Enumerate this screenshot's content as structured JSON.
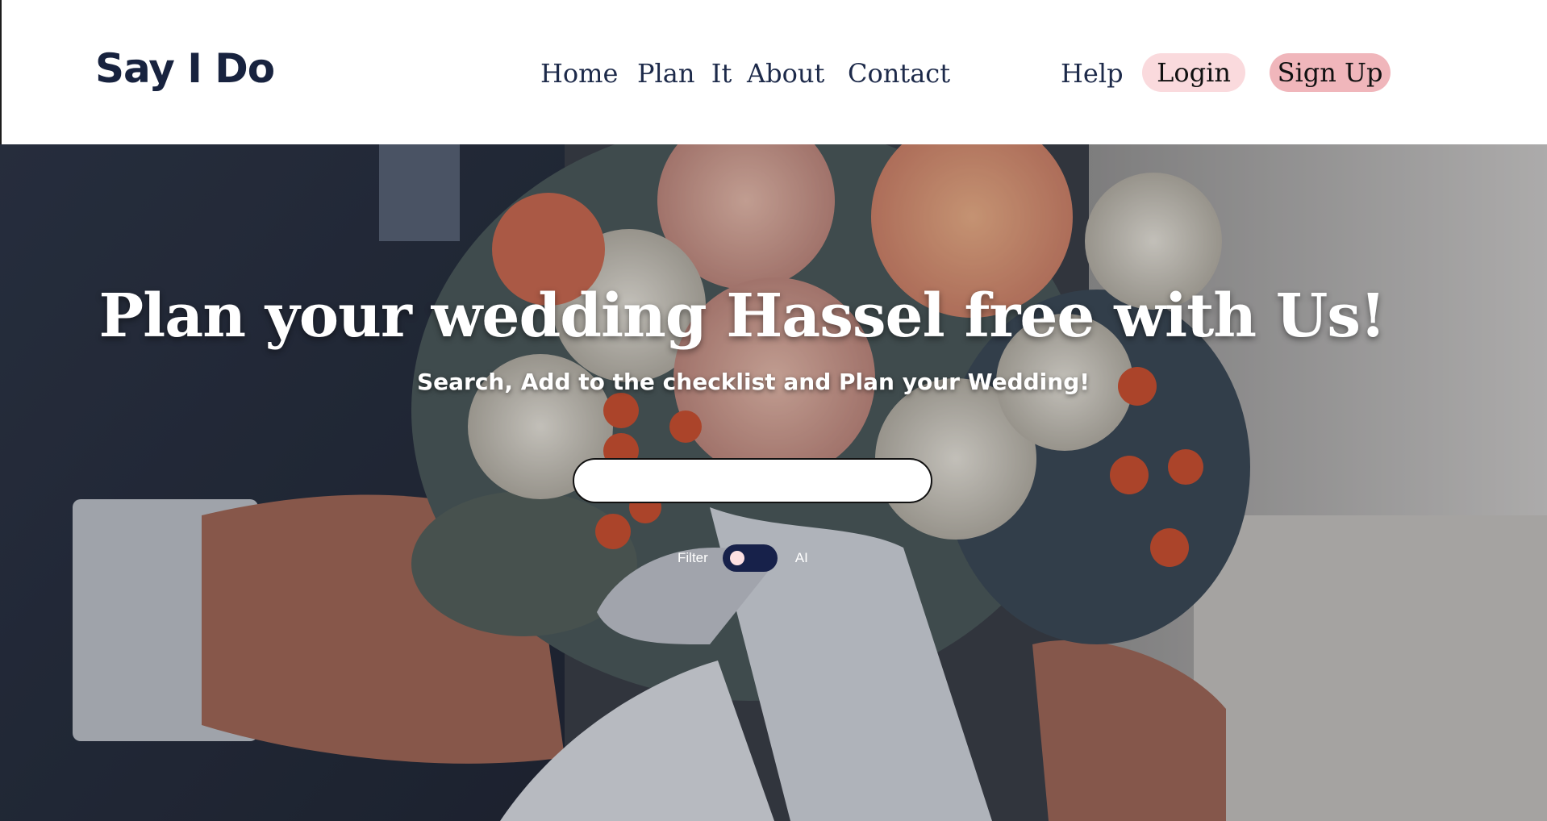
{
  "header": {
    "logo": "Say I Do",
    "nav": {
      "home": "Home",
      "plan": "Plan  It",
      "about": "About",
      "contact": "Contact",
      "help": "Help"
    },
    "login_label": "Login",
    "signup_label": "Sign Up"
  },
  "hero": {
    "title": "Plan your wedding Hassel free with Us!",
    "subtitle": "Search, Add to the checklist and Plan your Wedding!",
    "search": {
      "value": "",
      "placeholder": ""
    },
    "toggle": {
      "left_label": "Filter",
      "right_label": "AI",
      "state": "off"
    }
  },
  "colors": {
    "brand_navy": "#18233f",
    "login_pink": "#fadadd",
    "signup_pink": "#f0b6bb",
    "toggle_track": "#17214a"
  }
}
